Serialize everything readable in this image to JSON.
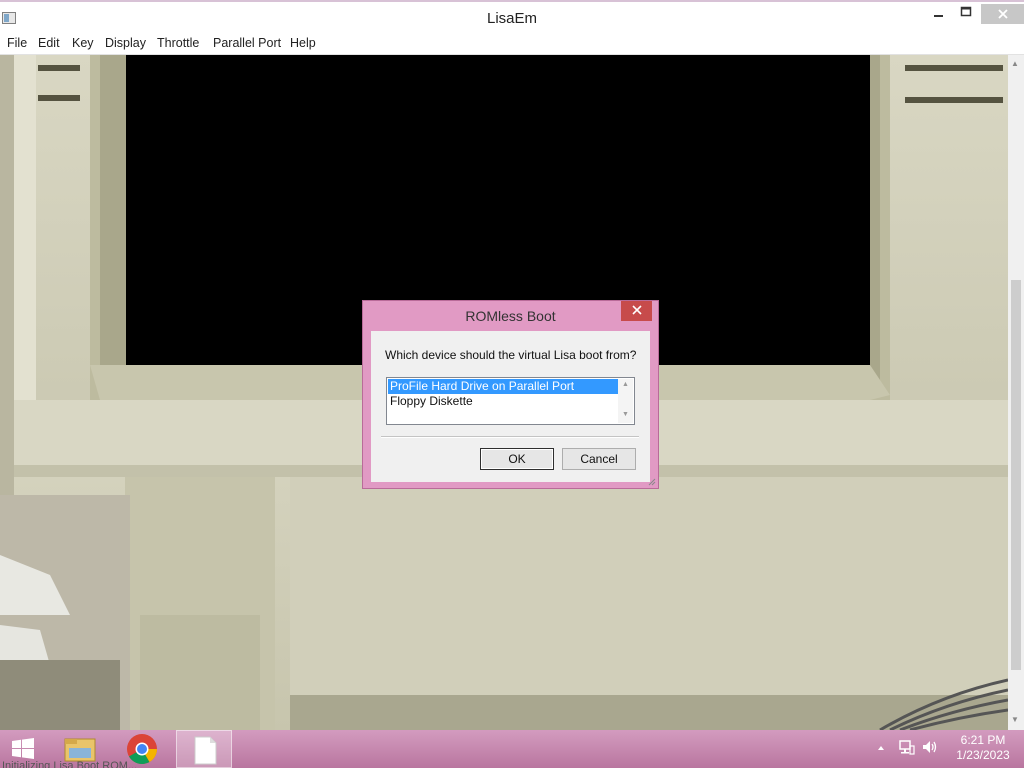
{
  "window": {
    "title": "LisaEm"
  },
  "menu": [
    "File",
    "Edit",
    "Key",
    "Display",
    "Throttle",
    "Parallel Port",
    "Help"
  ],
  "dialog": {
    "title": "ROMless Boot",
    "question": "Which device should the virtual Lisa boot from?",
    "options": [
      "ProFile Hard Drive on Parallel Port",
      "Floppy Diskette"
    ],
    "selected_index": 0,
    "ok_label": "OK",
    "cancel_label": "Cancel"
  },
  "status": {
    "text": "Initializing Lisa Boot ROM..."
  },
  "taskbar": {
    "apps": [
      "start-icon",
      "file-explorer-icon",
      "chrome-icon",
      "document-icon"
    ],
    "clock": {
      "time": "6:21 PM",
      "date": "1/23/2023"
    }
  },
  "colors": {
    "dialog_frame": "#e19ac4",
    "taskbar": "#c48bb2",
    "selection": "#3399ff",
    "close_button": "#c74b4b"
  }
}
